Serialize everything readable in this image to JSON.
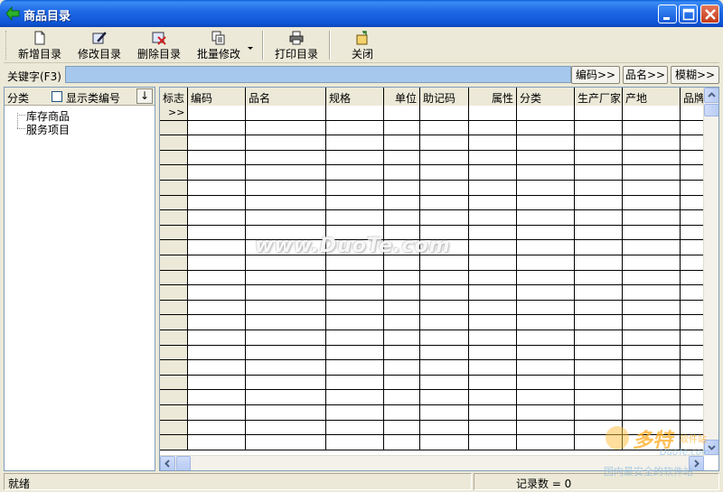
{
  "window": {
    "title": "商品目录",
    "controls": [
      "minimize-icon",
      "maximize-icon",
      "close-icon"
    ],
    "title_bar_color": "#0a5fd8"
  },
  "toolbar": {
    "new_label": "新增目录",
    "edit_label": "修改目录",
    "delete_label": "删除目录",
    "batch_label": "批量修改",
    "print_label": "打印目录",
    "close_label": "关闭"
  },
  "search": {
    "label": "关键字(F3)",
    "value": "",
    "code_button": "编码>>",
    "name_button": "品名>>",
    "fuzzy_button": "模糊>>",
    "input_color": "#a6c8ec"
  },
  "category": {
    "header_label": "分类",
    "show_code_label": "显示类编号",
    "show_code_checked": false,
    "sort_label": "↓",
    "items": [
      "库存商品",
      "服务项目"
    ]
  },
  "grid": {
    "columns": [
      "标志",
      "编码",
      "品名",
      "规格",
      "单位",
      "助记码",
      "属性",
      "分类",
      "生产厂家",
      "产地",
      "品牌"
    ],
    "current_row_marker": ">>",
    "rows": []
  },
  "status": {
    "ready": "就绪",
    "record_count_label": "记录数 = 0"
  },
  "watermark": {
    "main": "www.DuoTe.com",
    "brand": "多特",
    "brand_small": "软件站",
    "brand_en": "DuoTe.com",
    "tagline": "国内最安全的软件站"
  }
}
